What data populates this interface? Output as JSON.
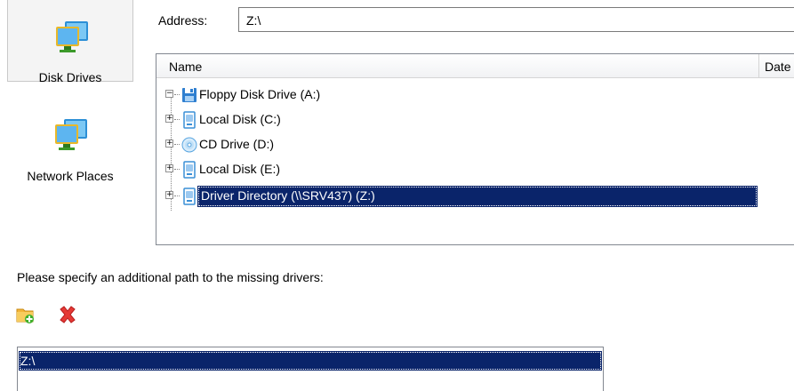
{
  "left_panel": {
    "items": [
      {
        "label": "Disk Drives",
        "icon": "monitor-icon",
        "selected": true
      },
      {
        "label": "Network Places",
        "icon": "network-monitor-icon",
        "selected": false
      }
    ]
  },
  "address": {
    "label": "Address:",
    "value": "Z:\\"
  },
  "tree": {
    "columns": [
      "Name",
      "Date"
    ],
    "nodes": [
      {
        "label": "Floppy Disk Drive (A:)",
        "icon": "floppy-disk-icon",
        "expander": "−",
        "selected": false
      },
      {
        "label": "Local Disk (C:)",
        "icon": "hard-disk-icon",
        "expander": "+",
        "selected": false
      },
      {
        "label": "CD Drive (D:)",
        "icon": "cd-drive-icon",
        "expander": "+",
        "selected": false
      },
      {
        "label": "Local Disk (E:)",
        "icon": "hard-disk-icon",
        "expander": "+",
        "selected": false
      },
      {
        "label": "Driver Directory (\\\\SRV437) (Z:)",
        "icon": "network-drive-icon",
        "expander": "+",
        "selected": true
      }
    ]
  },
  "prompt": "Please specify an additional path to the missing drivers:",
  "toolbar": {
    "add_icon": "add-folder-icon",
    "remove_icon": "delete-icon"
  },
  "paths": {
    "items": [
      "Z:\\"
    ]
  },
  "colors": {
    "selection": "#0a246a",
    "monitor_blue": "#3aa0e8",
    "delete_red": "#e53935"
  }
}
